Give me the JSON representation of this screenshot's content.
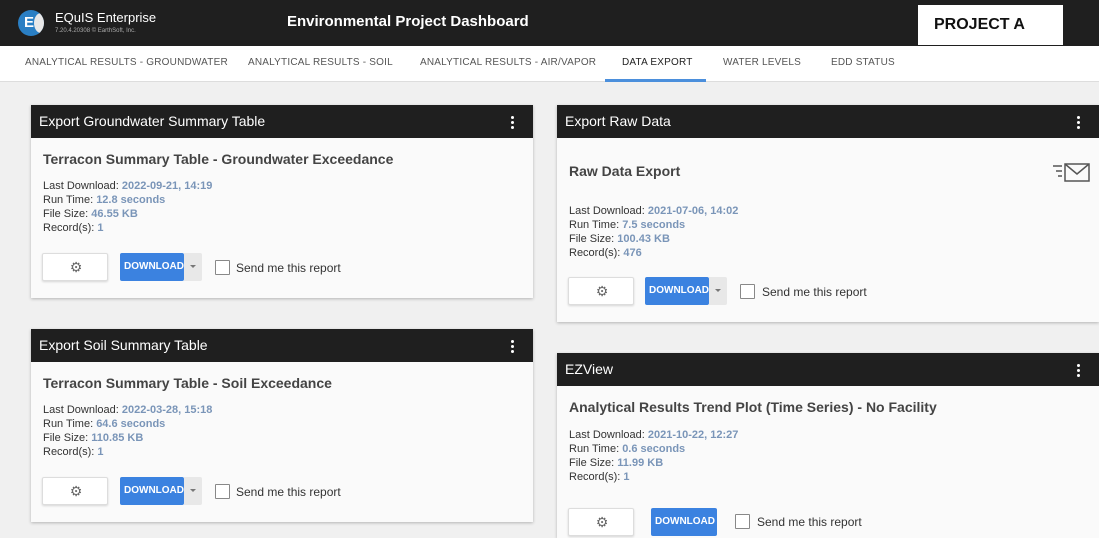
{
  "brand": {
    "name": "EQuIS Enterprise",
    "version": "7.20.4.20308 © EarthSoft, Inc.",
    "logo_letter": "E"
  },
  "app_title": "Environmental Project Dashboard",
  "project": "PROJECT A",
  "tabs": [
    {
      "label": "ANALYTICAL RESULTS - GROUNDWATER"
    },
    {
      "label": "ANALYTICAL RESULTS - SOIL"
    },
    {
      "label": "ANALYTICAL RESULTS - AIR/VAPOR"
    },
    {
      "label": "DATA EXPORT",
      "active": true
    },
    {
      "label": "WATER LEVELS"
    },
    {
      "label": "EDD STATUS"
    }
  ],
  "meta_labels": {
    "last_download": "Last Download: ",
    "run_time": "Run Time: ",
    "file_size": "File Size: ",
    "records": "Record(s): "
  },
  "common": {
    "download": "DOWNLOAD",
    "send_me": "Send me this report",
    "gear_icon": "gear-icon",
    "kebab_icon": "more-vert-icon",
    "mail_icon": "email-list-icon"
  },
  "cards": [
    {
      "header": "Export Groundwater Summary Table",
      "title": "Terracon Summary Table - Groundwater Exceedance",
      "last_download": "2022-09-21, 14:19",
      "run_time": "12.8 seconds",
      "file_size": "46.55 KB",
      "records": "1"
    },
    {
      "header": "Export Soil Summary Table",
      "title": "Terracon Summary Table - Soil Exceedance",
      "last_download": "2022-03-28, 15:18",
      "run_time": "64.6 seconds",
      "file_size": "110.85 KB",
      "records": "1"
    },
    {
      "header": "Export Raw Data",
      "title": "Raw Data Export",
      "last_download": "2021-07-06, 14:02",
      "run_time": "7.5 seconds",
      "file_size": "100.43 KB",
      "records": "476"
    },
    {
      "header": "EZView",
      "title": "Analytical Results Trend Plot (Time Series) - No Facility",
      "last_download": "2021-10-22, 12:27",
      "run_time": "0.6 seconds",
      "file_size": "11.99 KB",
      "records": "1"
    }
  ],
  "colors": {
    "topbar": "#1f1f1f",
    "accent": "#3b82e0",
    "value_text": "#7a95b8",
    "tab_underline": "#4b8fdc"
  }
}
